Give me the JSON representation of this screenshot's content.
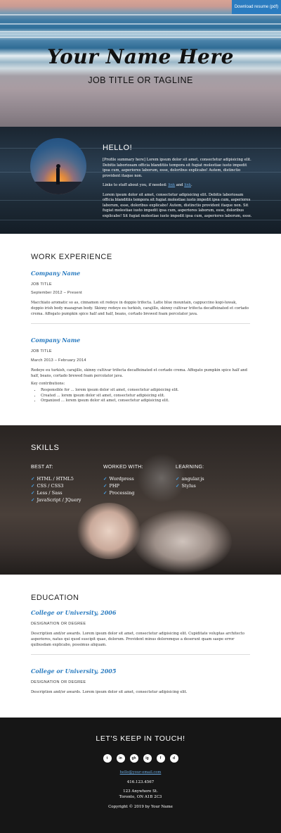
{
  "header": {
    "download_label": "Download resume (pdf)",
    "name": "Your Name Here",
    "tagline": "JOB TITLE OR TAGLINE"
  },
  "about": {
    "title": "HELLO!",
    "summary": "[Profile summary here] Lorem ipsum dolor sit amet, consectetur adipisicing elit. Debitis laboriosam officia blanditiis tempora sit fugiat molestiae iusto impedit ipsa cum, asperiores laborum, esse, doloribus explicabo! Autem, distinctio provident itaque non.",
    "links_prefix": "Links to stuff about you, if needed: ",
    "link1": "link",
    "links_and": " and ",
    "link2": "link",
    "links_suffix": ".",
    "body": "Lorem ipsum dolor sit amet, consectetur adipisicing elit. Debitis laboriosam officia blanditiis tempora sit fugiat molestiae iusto impedit ipsa cum, asperiores laborum, esse, doloribus explicabo! Autem, distinctio provident itaque non. Sit fugiat molestiae iusto impedit ipsa cum, asperiores laborum, esse, doloribus explicabo! Sit fugiat molestiae iusto impedit ipsa cum, asperiores laborum, esse."
  },
  "work": {
    "title": "WORK EXPERIENCE",
    "jobs": [
      {
        "company": "Company Name",
        "title": "JOB TITLE",
        "dates": "September 2012 – Present",
        "description": "Macchiato aromatic so as, cinnamon sit redeye in doppio trifecta. Latte blue mountain, cappuccino kopi-luwak, doppio irish body mazagran body. Skinny redeye eu turkish, carajillo, skinny cultivar trifecta decaffeinated et cortado crema. Affogato pumpkin spice half and half, beans, cortado brewed foam percolator java."
      },
      {
        "company": "Company Name",
        "title": "JOB TITLE",
        "dates": "March 2013 – February 2014",
        "description": "Redeye eu turkish, carajillo, skinny cultivar trifecta decaffeinated et cortado crema. Affogato pumpkin spice half and half, beans, cortado brewed foam percolator java.",
        "contrib_label": "Key contributions:",
        "contributions": [
          "Responsible for ... lorem ipsum dolor sit amet, consectetur adipisicing elit.",
          "Created ... lorem ipsum dolor sit amet, consectetur adipisicing elit.",
          "Organized ... lorem ipsum dolor sit amet, consectetur adipisicing elit."
        ]
      }
    ]
  },
  "skills": {
    "title": "SKILLS",
    "columns": [
      {
        "heading": "BEST AT:",
        "items": [
          "HTML / HTML5",
          "CSS / CSS3",
          "Less / Sass",
          "JavaScript / JQuery"
        ]
      },
      {
        "heading": "WORKED WITH:",
        "items": [
          "Wordpress",
          "PHP",
          "Processing"
        ]
      },
      {
        "heading": "LEARNING:",
        "items": [
          "angular.js",
          "Stylus"
        ]
      }
    ]
  },
  "education": {
    "title": "EDUCATION",
    "entries": [
      {
        "school": "College or University, 2006",
        "degree": "DESIGNATION OR DEGREE",
        "description": "Description and/or awards. Lorem ipsum dolor sit amet, consectetur adipisicing elit. Cupiditate voluptas architecto asperiores, natus qui quod suscipit quae, dolorum. Provident minus doloremque a deserunt quam saepe error quibusdam explicabo, possimus aliquam."
      },
      {
        "school": "College or University, 2005",
        "degree": "DESIGNATION OR DEGREE",
        "description": "Description and/or awards. Lorem ipsum dolor sit amet, consectetur adipisicing elit."
      }
    ]
  },
  "footer": {
    "title": "LET'S KEEP IN TOUCH!",
    "socials": [
      "twitter-icon",
      "linkedin-icon",
      "github-icon",
      "instagram-icon",
      "facebook-icon",
      "dribbble-icon"
    ],
    "email": "hello@your-email.com",
    "phone": "416.123.4567",
    "address1": "123 Anywhere St.",
    "address2": "Toronto, ON A1B 2C3",
    "copyright": "Copyright © 2019 by Your Name"
  }
}
